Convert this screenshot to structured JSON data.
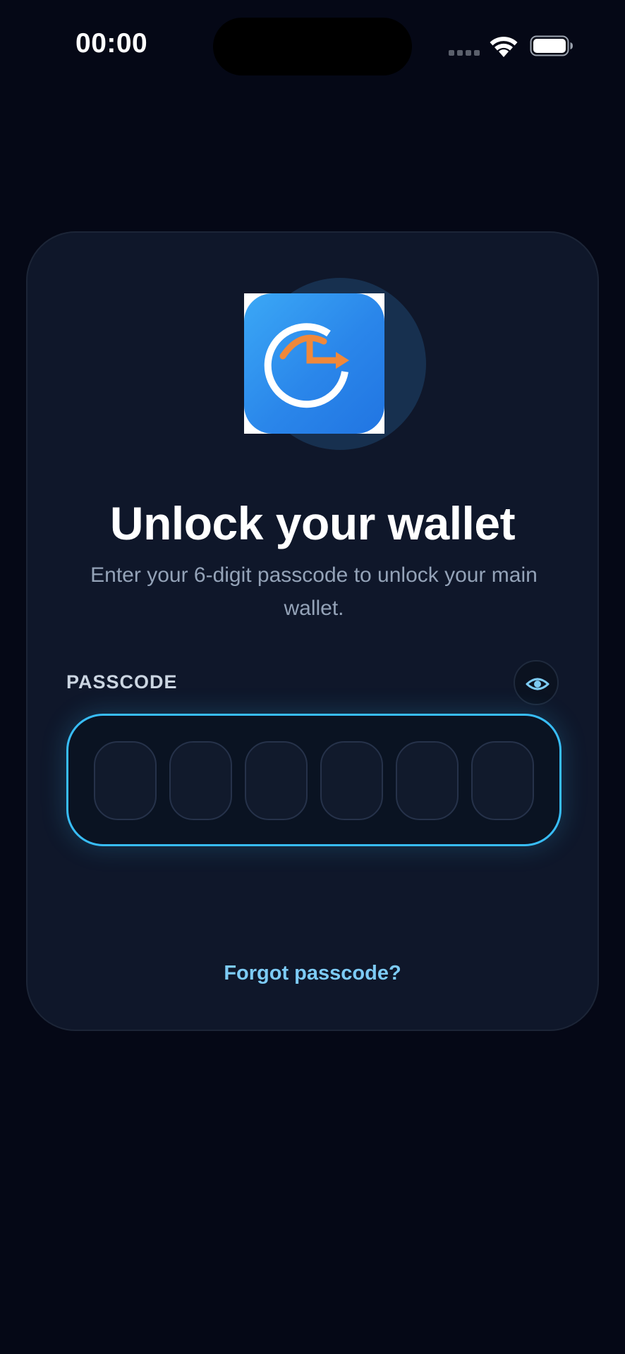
{
  "status_bar": {
    "time": "00:00",
    "signal_icon": "signal-dots-icon",
    "wifi_icon": "wifi-icon",
    "battery_icon": "battery-icon"
  },
  "unlock": {
    "logo_icon": "app-logo-icon",
    "title": "Unlock your wallet",
    "subtitle": "Enter your 6-digit passcode to unlock your main wallet.",
    "passcode_label": "PASSCODE",
    "toggle_visibility_icon": "eye-icon",
    "digit_count": 6,
    "digits_entered": [
      "",
      "",
      "",
      "",
      "",
      ""
    ],
    "forgot_link": "Forgot passcode?"
  },
  "colors": {
    "background": "#050816",
    "card": "#0f172a",
    "accent": "#38bdf8",
    "link": "#7dcbf5",
    "logo_orange": "#f0883a",
    "logo_blue": "#2a86ea"
  }
}
